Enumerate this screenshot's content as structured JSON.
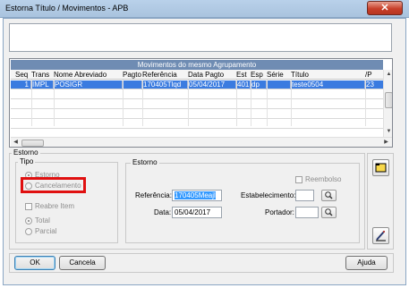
{
  "window": {
    "title": "Estorna Título / Movimentos  -  APB",
    "close_glyph": "✕"
  },
  "grid": {
    "caption": "Movimentos do mesmo Agrupamento",
    "columns": [
      "Seq",
      "Trans",
      "Nome Abreviado",
      "Pagto",
      "Referência",
      "Data Pagto",
      "Est",
      "Esp",
      "Série",
      "Título",
      "/P"
    ],
    "rows": [
      {
        "seq": "1",
        "trans": "IMPL",
        "nome": "POSIGR",
        "pagto": "",
        "referencia": "170405Tlqd",
        "data_pagto": "05/04/2017",
        "est": "401",
        "esp": "dp",
        "serie": "",
        "titulo": "teste0504",
        "p": "23"
      }
    ],
    "scroll": {
      "up": "▲",
      "down": "▼",
      "left": "◀",
      "right": "▶"
    }
  },
  "estorno_section": {
    "legend": "Estorno",
    "tipo": {
      "legend": "Tipo",
      "options": [
        "Estorno",
        "Cancelamento"
      ],
      "selected": "Estorno"
    },
    "reabre_item": "Reabre Item",
    "scope": {
      "options": [
        "Total",
        "Parcial"
      ],
      "selected": "Total"
    },
    "inner": {
      "legend": "Estorno",
      "reembolso": "Reembolso",
      "referencia_label": "Referência:",
      "referencia_value": "170405Meajl",
      "data_label": "Data:",
      "data_value": "05/04/2017",
      "estabelecimento_label": "Estabelecimento:",
      "estabelecimento_value": "",
      "portador_label": "Portador:",
      "portador_value": ""
    }
  },
  "icons": {
    "lookup": "magnifier-icon",
    "folder": "folder-icon",
    "edit": "pencil-icon"
  },
  "buttons": {
    "ok": "OK",
    "cancel": "Cancela",
    "help": "Ajuda"
  },
  "colors": {
    "selection_row": "#3a7be0",
    "grid_caption": "#6f8cb3",
    "highlight_box": "#e01010"
  }
}
